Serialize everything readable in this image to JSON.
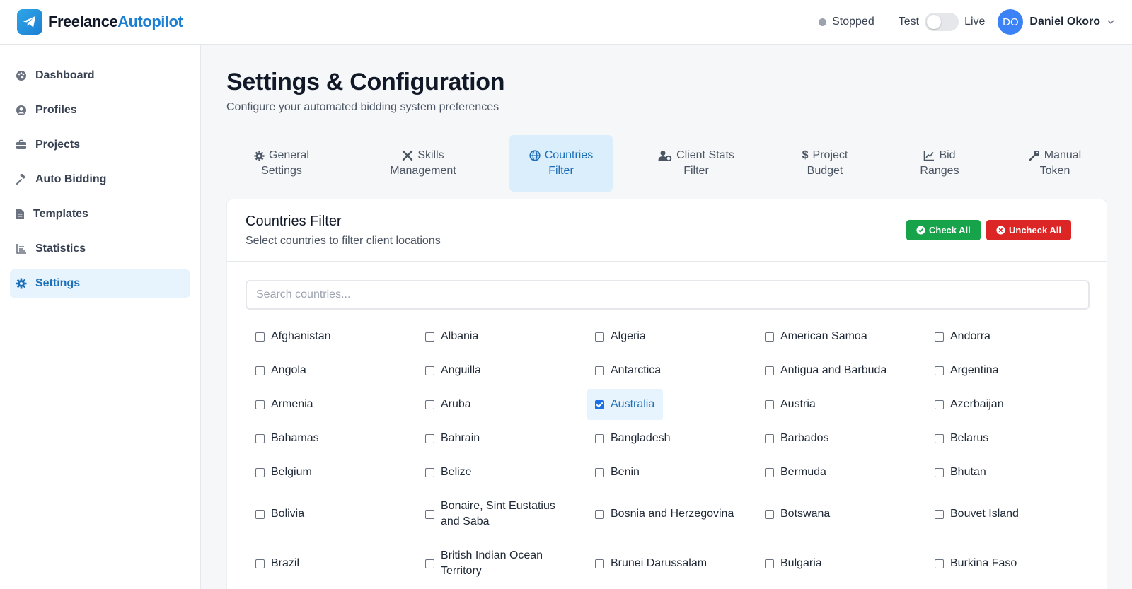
{
  "app": {
    "name_part1": "Freelance",
    "name_part2": "Autopilot"
  },
  "header": {
    "status": "Stopped",
    "mode_left": "Test",
    "mode_right": "Live",
    "user_initials": "DO",
    "user_name": "Daniel Okoro"
  },
  "sidebar": {
    "items": [
      {
        "label": "Dashboard",
        "icon": "palette-icon"
      },
      {
        "label": "Profiles",
        "icon": "user-circle-icon"
      },
      {
        "label": "Projects",
        "icon": "briefcase-icon"
      },
      {
        "label": "Auto Bidding",
        "icon": "gavel-icon"
      },
      {
        "label": "Templates",
        "icon": "file-icon"
      },
      {
        "label": "Statistics",
        "icon": "chart-icon"
      },
      {
        "label": "Settings",
        "icon": "gear-icon",
        "active": true
      }
    ]
  },
  "page": {
    "title": "Settings & Configuration",
    "subtitle": "Configure your automated bidding system preferences"
  },
  "tabs": [
    {
      "line1": "General",
      "line2": "Settings",
      "icon": "gear-icon"
    },
    {
      "line1": "Skills",
      "line2": "Management",
      "icon": "tools-icon"
    },
    {
      "line1": "Countries",
      "line2": "Filter",
      "icon": "globe-icon",
      "active": true
    },
    {
      "line1": "Client Stats",
      "line2": "Filter",
      "icon": "user-cog-icon"
    },
    {
      "line1": "Project",
      "line2": "Budget",
      "icon": "dollar-icon"
    },
    {
      "line1": "Bid",
      "line2": "Ranges",
      "icon": "line-chart-icon"
    },
    {
      "line1": "Manual",
      "line2": "Token",
      "icon": "key-icon"
    }
  ],
  "countries_filter": {
    "title": "Countries Filter",
    "subtitle": "Select countries to filter client locations",
    "check_all": "Check All",
    "uncheck_all": "Uncheck All",
    "search_placeholder": "Search countries...",
    "search_value": "",
    "countries": [
      {
        "name": "Afghanistan",
        "checked": false
      },
      {
        "name": "Albania",
        "checked": false
      },
      {
        "name": "Algeria",
        "checked": false
      },
      {
        "name": "American Samoa",
        "checked": false
      },
      {
        "name": "Andorra",
        "checked": false
      },
      {
        "name": "Angola",
        "checked": false
      },
      {
        "name": "Anguilla",
        "checked": false
      },
      {
        "name": "Antarctica",
        "checked": false
      },
      {
        "name": "Antigua and Barbuda",
        "checked": false
      },
      {
        "name": "Argentina",
        "checked": false
      },
      {
        "name": "Armenia",
        "checked": false
      },
      {
        "name": "Aruba",
        "checked": false
      },
      {
        "name": "Australia",
        "checked": true
      },
      {
        "name": "Austria",
        "checked": false
      },
      {
        "name": "Azerbaijan",
        "checked": false
      },
      {
        "name": "Bahamas",
        "checked": false
      },
      {
        "name": "Bahrain",
        "checked": false
      },
      {
        "name": "Bangladesh",
        "checked": false
      },
      {
        "name": "Barbados",
        "checked": false
      },
      {
        "name": "Belarus",
        "checked": false
      },
      {
        "name": "Belgium",
        "checked": false
      },
      {
        "name": "Belize",
        "checked": false
      },
      {
        "name": "Benin",
        "checked": false
      },
      {
        "name": "Bermuda",
        "checked": false
      },
      {
        "name": "Bhutan",
        "checked": false
      },
      {
        "name": "Bolivia",
        "checked": false
      },
      {
        "name": "Bonaire, Sint Eustatius and Saba",
        "checked": false
      },
      {
        "name": "Bosnia and Herzegovina",
        "checked": false
      },
      {
        "name": "Botswana",
        "checked": false
      },
      {
        "name": "Bouvet Island",
        "checked": false
      },
      {
        "name": "Brazil",
        "checked": false
      },
      {
        "name": "British Indian Ocean Territory",
        "checked": false
      },
      {
        "name": "Brunei Darussalam",
        "checked": false
      },
      {
        "name": "Bulgaria",
        "checked": false
      },
      {
        "name": "Burkina Faso",
        "checked": false
      }
    ]
  }
}
